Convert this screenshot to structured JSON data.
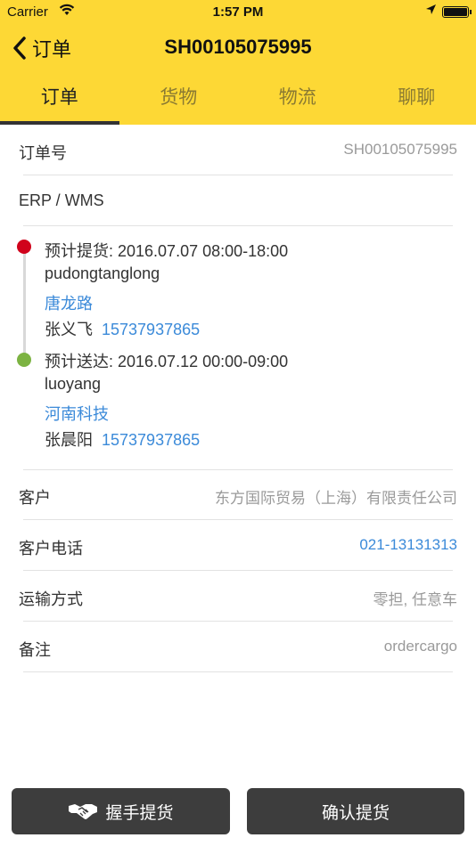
{
  "status_bar": {
    "carrier": "Carrier",
    "time": "1:57 PM"
  },
  "nav": {
    "back_label": "订单",
    "title": "SH00105075995"
  },
  "tabs": [
    {
      "label": "订单",
      "active": true
    },
    {
      "label": "货物",
      "active": false
    },
    {
      "label": "物流",
      "active": false
    },
    {
      "label": "聊聊",
      "active": false
    }
  ],
  "order": {
    "number_label": "订单号",
    "number_value": "SH00105075995",
    "erp_label": "ERP / WMS"
  },
  "timeline": {
    "pickup": {
      "title": "预计提货: 2016.07.07 08:00-18:00",
      "place": "pudongtanglong",
      "address": "唐龙路",
      "contact_name": "张义飞",
      "contact_phone": "15737937865"
    },
    "delivery": {
      "title": "预计送达: 2016.07.12 00:00-09:00",
      "place": "luoyang",
      "address": "河南科技",
      "contact_name": "张晨阳",
      "contact_phone": "15737937865"
    }
  },
  "details": [
    {
      "label": "客户",
      "value": "东方国际贸易（上海）有限责任公司",
      "link": false
    },
    {
      "label": "客户电话",
      "value": "021-13131313",
      "link": true
    },
    {
      "label": "运输方式",
      "value": "零担, 任意车",
      "link": false
    },
    {
      "label": "备注",
      "value": "ordercargo",
      "link": false
    }
  ],
  "actions": {
    "handshake_label": "握手提货",
    "confirm_label": "确认提货"
  },
  "colors": {
    "header": "#fdd835",
    "link": "#3b8ad9",
    "button": "#3d3d3d",
    "pickup_dot": "#d0021b",
    "delivery_dot": "#7cb342"
  }
}
